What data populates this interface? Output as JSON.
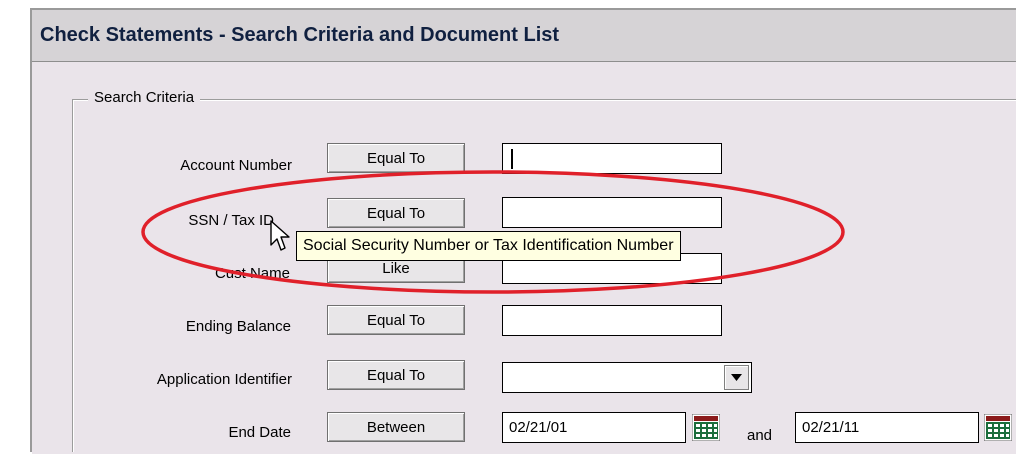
{
  "window": {
    "title": "Check Statements - Search Criteria and Document List"
  },
  "search_criteria": {
    "legend": "Search Criteria",
    "rows": [
      {
        "label": "Account Number",
        "operator": "Equal To",
        "value": ""
      },
      {
        "label": "SSN / Tax ID",
        "operator": "Equal To",
        "value": ""
      },
      {
        "label": "Cust Name",
        "operator": "Like",
        "value": ""
      },
      {
        "label": "Ending Balance",
        "operator": "Equal To",
        "value": ""
      },
      {
        "label": "Application Identifier",
        "operator": "Equal To",
        "value": ""
      },
      {
        "label": "End Date",
        "operator": "Between",
        "from": "02/21/01",
        "conjunction": "and",
        "to": "02/21/11"
      }
    ]
  },
  "tooltip": {
    "text": "Social Security Number or Tax Identification Number"
  },
  "icons": {
    "calendar": "calendar-icon",
    "dropdown": "chevron-down-icon",
    "cursor": "mouse-pointer-icon"
  },
  "colors": {
    "highlight_ellipse": "#e0202a",
    "window_background": "#eae4ea",
    "title_bar": "#d6d3d6",
    "title_text": "#102040",
    "tooltip_background": "#ffffe1"
  }
}
